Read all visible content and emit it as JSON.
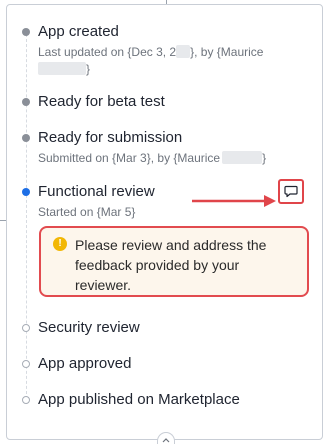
{
  "steps": [
    {
      "title": "App created",
      "status": "done",
      "subtitle_parts": [
        "Last updated on {Dec 3, 2",
        "}, by {Maurice",
        "}"
      ]
    },
    {
      "title": "Ready for beta test",
      "status": "done"
    },
    {
      "title": "Ready for submission",
      "status": "done",
      "subtitle_parts": [
        "Submitted on {Mar 3}, by {Maurice",
        "}"
      ]
    },
    {
      "title": "Functional review",
      "status": "current",
      "subtitle": "Started on {Mar 5}"
    },
    {
      "title": "Security review",
      "status": "pending"
    },
    {
      "title": "App approved",
      "status": "pending"
    },
    {
      "title": "App published on Marketplace",
      "status": "pending"
    }
  ],
  "alert": {
    "icon": "exclamation",
    "text": "Please review and address the feedback provided by your reviewer."
  },
  "colors": {
    "current_dot": "#1e6fe6",
    "alert_border": "#e24b4f",
    "annotation_red": "#e0454a",
    "alert_bg": "#fdf6ec"
  },
  "icons": {
    "comment": "comment-icon",
    "annotation_arrow": "arrow-right-icon",
    "expand": "chevron-up-icon"
  }
}
